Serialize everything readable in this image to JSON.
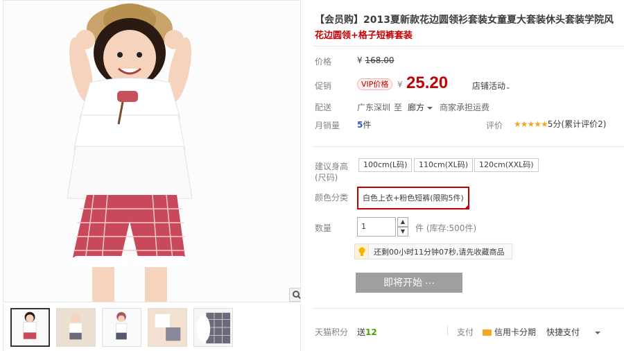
{
  "product": {
    "title": "【会员购】2013夏新款花边圆领衫套装女童夏大套装休头套装学院风",
    "subtitle": "花边圆领+格子短裤套装"
  },
  "price": {
    "label": "价格",
    "currency": "¥",
    "original": "168.00"
  },
  "promo": {
    "label": "促销",
    "vip_badge": "VIP价格",
    "currency": "¥",
    "price": "25.20",
    "store_activity": "店铺活动"
  },
  "delivery": {
    "label": "配送",
    "from": "广东深圳",
    "to_label": "至",
    "to": "廊方",
    "shipping": "商家承担运费"
  },
  "sales": {
    "label": "月销量",
    "count": "5",
    "unit": "件",
    "rating_label": "评价",
    "stars": "★★★★★",
    "rating_text": "5分(累计评价2)"
  },
  "size": {
    "label": "建议身高(尺码)",
    "options": [
      "100cm(L码)",
      "110cm(XL码)",
      "120cm(XXL码)"
    ]
  },
  "color": {
    "label": "颜色分类",
    "selected": "白色上衣+粉色短裤(限购5件)"
  },
  "quantity": {
    "label": "数量",
    "value": "1",
    "unit_stock": "件 (库存:500件)"
  },
  "tip": {
    "text": "还剩00小时11分钟07秒,请先收藏商品"
  },
  "buy_button": "即将开始 ···",
  "bottom": {
    "points_label": "天猫积分",
    "points_prefix": "送",
    "points_value": "12",
    "pay_label": "支付",
    "credit": "信用卡分期",
    "quick_pay": "快捷支付"
  },
  "colors": {
    "accent": "#c40000",
    "button": "#9f9f9f",
    "points": "#4a9e00",
    "sales": "#2b5bc9"
  }
}
